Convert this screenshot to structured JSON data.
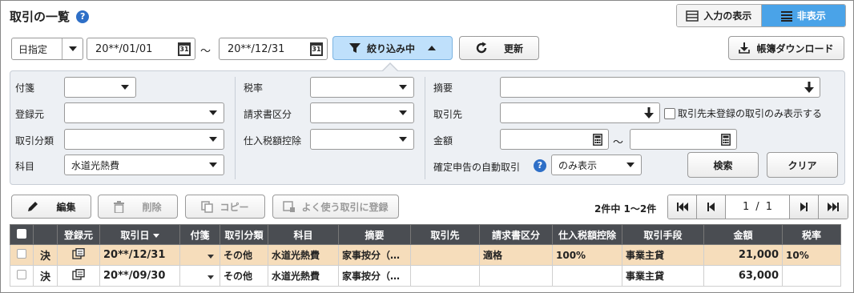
{
  "header": {
    "title": "取引の一覧",
    "help": "?"
  },
  "view_toggle": {
    "show_label": "入力の表示",
    "hide_label": "非表示"
  },
  "toolbar": {
    "date_mode": "日指定",
    "date_from": "20**/01/01",
    "date_sep": "〜",
    "date_to": "20**/12/31",
    "calendar_glyph": "31",
    "filter_label": "絞り込み中",
    "refresh_label": "更新",
    "download_label": "帳簿ダウンロード"
  },
  "filters": {
    "fusen": "付箋",
    "touroku_moto": "登録元",
    "torihiki_bunrui": "取引分類",
    "kamoku": "科目",
    "kamoku_value": "水道光熱費",
    "zeiritsu": "税率",
    "seikyusho_kubun": "請求書区分",
    "shiire_koujo": "仕入税額控除",
    "tekiyou": "摘要",
    "torihikisaki": "取引先",
    "unregistered_only": "取引先未登録の取引のみ表示する",
    "kingaku": "金額",
    "amount_sep": "〜",
    "auto_label": "確定申告の自動取引",
    "auto_help": "?",
    "auto_value": "のみ表示",
    "search_label": "検索",
    "clear_label": "クリア"
  },
  "actions": {
    "edit_label": "編集",
    "delete_label": "削除",
    "copy_label": "コピー",
    "fav_label": "よく使う取引に登録"
  },
  "pagination": {
    "summary": "2件中 1〜2件",
    "current": "1",
    "sep": "/",
    "total": "1"
  },
  "table": {
    "headers": [
      "登録元",
      "取引日",
      "付箋",
      "取引分類",
      "科目",
      "摘要",
      "取引先",
      "請求書区分",
      "仕入税額控除",
      "取引手段",
      "金額",
      "税率"
    ],
    "rows": [
      {
        "kettei": "決",
        "date": "20**/12/31",
        "bunrui": "その他",
        "kamoku": "水道光熱費",
        "tekiyou": "家事按分（…",
        "torihikisaki": "",
        "seikyu": "適格",
        "koujo": "100%",
        "shudan": "事業主貸",
        "kingaku": "21,000",
        "zeiritsu": "10%"
      },
      {
        "kettei": "決",
        "date": "20**/09/30",
        "bunrui": "その他",
        "kamoku": "水道光熱費",
        "tekiyou": "家事按分（…",
        "torihikisaki": "",
        "seikyu": "",
        "koujo": "",
        "shudan": "事業主貸",
        "kingaku": "63,000",
        "zeiritsu": ""
      }
    ]
  },
  "colors": {
    "accent": "#4aa3e8",
    "header_bg": "#4a4d52",
    "selected_row": "#f6ddbb",
    "panel_bg": "#edf0f4"
  }
}
